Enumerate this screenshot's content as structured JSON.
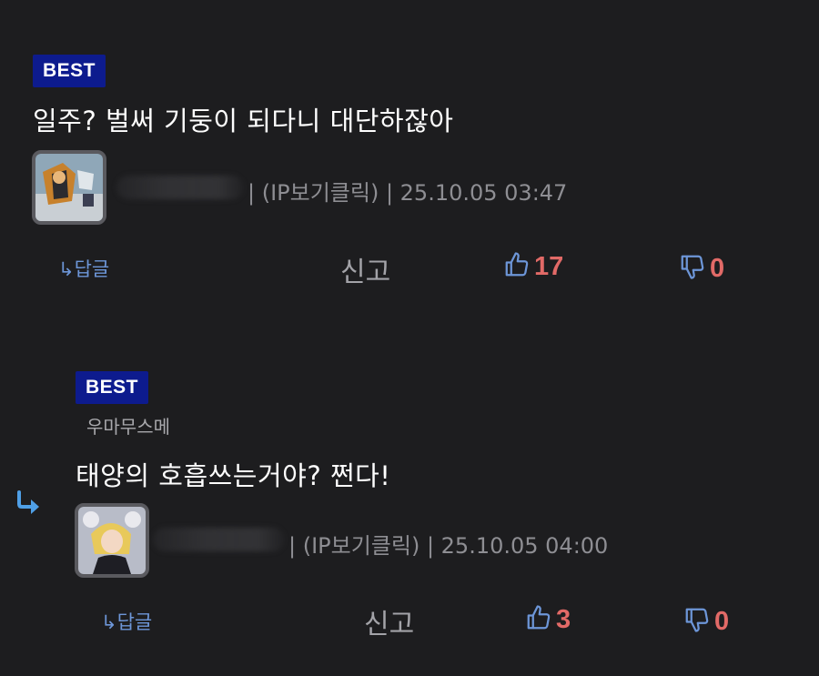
{
  "colors": {
    "background": "#1d1d1f",
    "badge": "#0d1b8e",
    "accent_blue": "#6d96d8",
    "vote_count": "#e26a67",
    "meta_text": "#8e8e93"
  },
  "comments": [
    {
      "badge": "BEST",
      "parent_name": "",
      "text": "일주? 벌써 기둥이 되다니 대단하잖아",
      "ip_label": "| (IP보기클릭) | 25.10.05 03:47",
      "reply_label": "↳답글",
      "report_label": "신고",
      "upvotes": "17",
      "downvotes": "0"
    },
    {
      "badge": "BEST",
      "parent_name": "우마무스메",
      "text": "태양의 호흡쓰는거야? 쩐다!",
      "ip_label": "| (IP보기클릭) | 25.10.05 04:00",
      "reply_label": "↳답글",
      "report_label": "신고",
      "upvotes": "3",
      "downvotes": "0"
    }
  ]
}
